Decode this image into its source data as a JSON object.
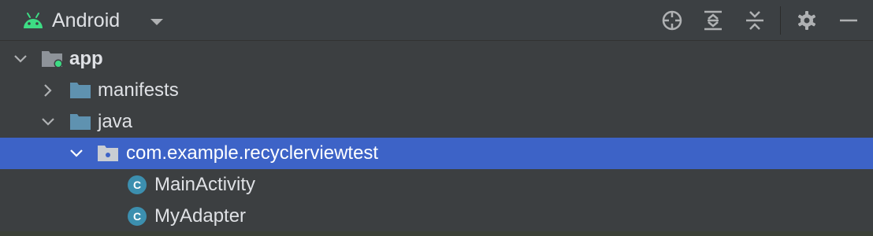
{
  "toolbar": {
    "view_title": "Android",
    "icons": [
      "android-icon",
      "chevron-down-icon",
      "locate-icon",
      "expand-all-icon",
      "collapse-all-icon",
      "gear-icon",
      "minimize-icon"
    ]
  },
  "tree": {
    "nodes": [
      {
        "label": "app",
        "icon": "module-folder-icon",
        "expanded": true
      },
      {
        "label": "manifests",
        "icon": "folder-icon",
        "expanded": false
      },
      {
        "label": "java",
        "icon": "folder-icon",
        "expanded": true
      },
      {
        "label": "com.example.recyclerviewtest",
        "icon": "package-icon",
        "expanded": true,
        "selected": true
      },
      {
        "label": "MainActivity",
        "icon": "class-icon"
      },
      {
        "label": "MyAdapter",
        "icon": "class-icon"
      }
    ]
  },
  "colors": {
    "panel_bg": "#3c3f41",
    "selection": "#3d63c7",
    "folder": "#5f92b0",
    "android_green": "#3ddc84",
    "class_icon": "#3c8faf",
    "text": "#dfe1e5"
  }
}
